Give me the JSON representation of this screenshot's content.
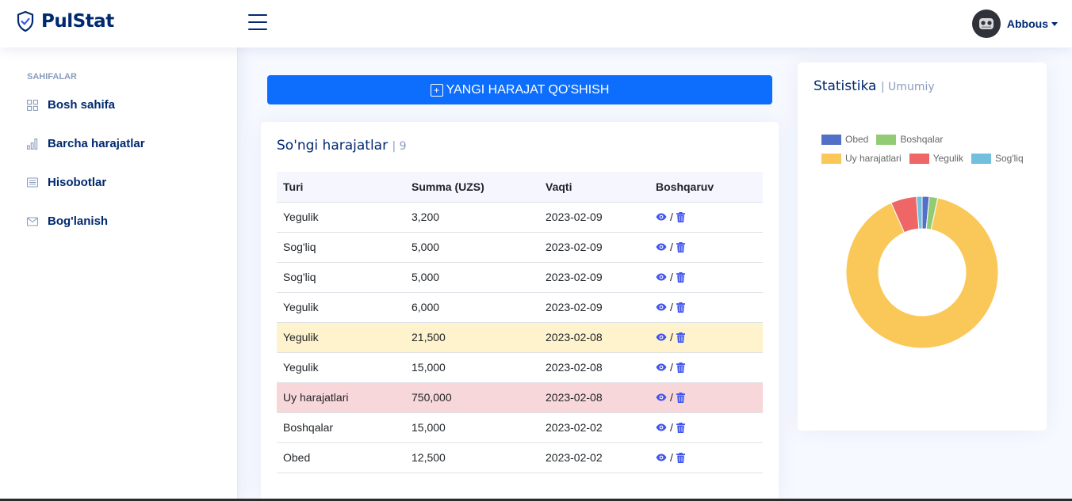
{
  "header": {
    "logo_text": "PulStat",
    "user_name": "Abbous",
    "icons": {
      "logo": "shield-check-icon",
      "menu": "hamburger-icon",
      "avatar": "user-avatar"
    }
  },
  "sidebar": {
    "heading": "SAHIFALAR",
    "items": [
      {
        "label": "Bosh sahifa",
        "icon": "grid-icon"
      },
      {
        "label": "Barcha harajatlar",
        "icon": "bar-chart-icon"
      },
      {
        "label": "Hisobotlar",
        "icon": "card-list-icon"
      },
      {
        "label": "Bog'lanish",
        "icon": "envelope-icon"
      }
    ]
  },
  "main": {
    "add_button": "YANGI HARAJAT QO'SHISH",
    "recent": {
      "title": "So'ngi harajatlar",
      "count": "| 9",
      "columns": [
        "Turi",
        "Summa (UZS)",
        "Vaqti",
        "Boshqaruv"
      ],
      "separator": "/",
      "rows": [
        {
          "type": "Yegulik",
          "amount": "3,200",
          "date": "2023-02-09",
          "highlight": ""
        },
        {
          "type": "Sog'liq",
          "amount": "5,000",
          "date": "2023-02-09",
          "highlight": ""
        },
        {
          "type": "Sog'liq",
          "amount": "5,000",
          "date": "2023-02-09",
          "highlight": ""
        },
        {
          "type": "Yegulik",
          "amount": "6,000",
          "date": "2023-02-09",
          "highlight": ""
        },
        {
          "type": "Yegulik",
          "amount": "21,500",
          "date": "2023-02-08",
          "highlight": "warning"
        },
        {
          "type": "Yegulik",
          "amount": "15,000",
          "date": "2023-02-08",
          "highlight": ""
        },
        {
          "type": "Uy harajatlari",
          "amount": "750,000",
          "date": "2023-02-08",
          "highlight": "danger"
        },
        {
          "type": "Boshqalar",
          "amount": "15,000",
          "date": "2023-02-02",
          "highlight": ""
        },
        {
          "type": "Obed",
          "amount": "12,500",
          "date": "2023-02-02",
          "highlight": ""
        }
      ]
    }
  },
  "stats": {
    "title": "Statistika",
    "subtitle": "| Umumiy",
    "legend": [
      {
        "label": "Obed",
        "color": "#5470c6"
      },
      {
        "label": "Boshqalar",
        "color": "#91cc75"
      },
      {
        "label": "Uy harajatlari",
        "color": "#fac858"
      },
      {
        "label": "Yegulik",
        "color": "#ee6666"
      },
      {
        "label": "Sog'liq",
        "color": "#73c0de"
      }
    ]
  },
  "chart_data": {
    "type": "pie",
    "variant": "doughnut",
    "labels": [
      "Obed",
      "Boshqalar",
      "Uy harajatlari",
      "Yegulik",
      "Sog'liq"
    ],
    "values": [
      12500,
      15000,
      750000,
      45700,
      10000
    ],
    "colors": [
      "#5470c6",
      "#91cc75",
      "#fac858",
      "#ee6666",
      "#73c0de"
    ],
    "legend_position": "top"
  }
}
